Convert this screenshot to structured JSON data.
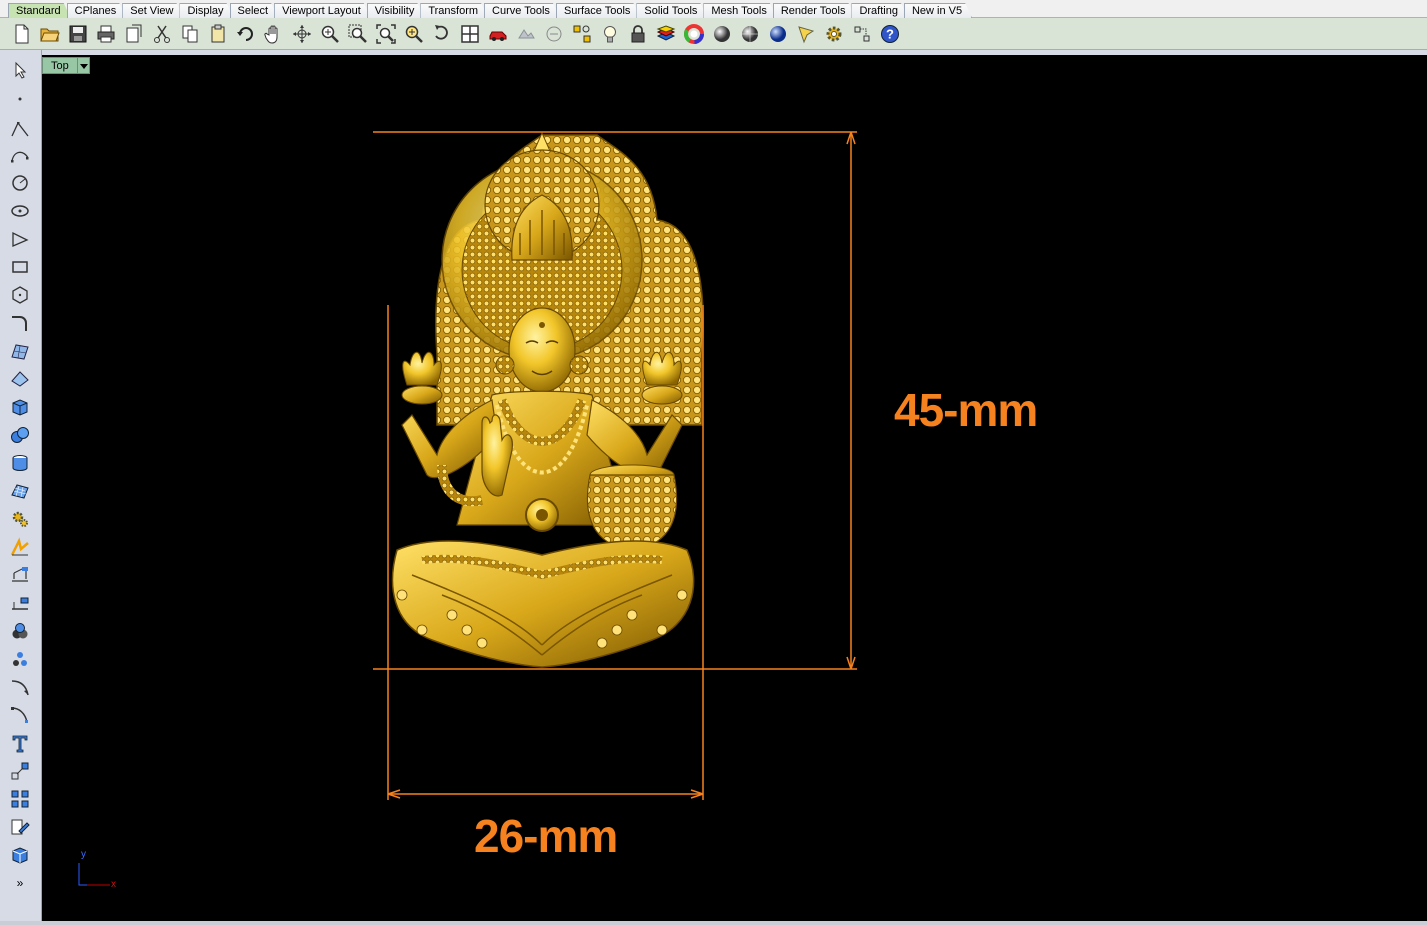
{
  "tabs": [
    "Standard",
    "CPlanes",
    "Set View",
    "Display",
    "Select",
    "Viewport Layout",
    "Visibility",
    "Transform",
    "Curve Tools",
    "Surface Tools",
    "Solid Tools",
    "Mesh Tools",
    "Render Tools",
    "Drafting",
    "New in V5"
  ],
  "active_tab": "Standard",
  "toolbar": {
    "icons": [
      "new-file-icon",
      "open-folder-icon",
      "save-icon",
      "print-icon",
      "import-icon",
      "cut-icon",
      "copy-icon",
      "paste-icon",
      "undo-icon",
      "pan-hand-icon",
      "rotate-view-icon",
      "zoom-in-icon",
      "zoom-window-icon",
      "zoom-extents-icon",
      "zoom-selected-icon",
      "rotate-arrow-icon",
      "four-viewports-icon",
      "car-icon",
      "disabled-icon",
      "circle-arrow-icon",
      "points-icon",
      "light-bulb-icon",
      "lock-icon",
      "layer-icon",
      "color-wheel-icon",
      "sphere-shade-icon",
      "sphere-render-icon",
      "sphere-blue-icon",
      "pen-tool-icon",
      "settings-gear-icon",
      "grid-snap-icon",
      "help-icon"
    ]
  },
  "left_toolbar": {
    "icons": [
      "select-arrow-icon",
      "point-icon",
      "polyline-icon",
      "curve-icon",
      "circle-icon",
      "ellipse-icon",
      "arc-icon",
      "rectangle-icon",
      "polygon-icon",
      "curve-from-object-icon",
      "surface-icon",
      "surface-edit-icon",
      "box-solid-icon",
      "boolean-icon",
      "cylinder-solid-icon",
      "mesh-icon",
      "gear-tool-icon",
      "render-analysis-icon",
      "dimension-icon",
      "dimension-line-icon",
      "boolean-union-icon",
      "points-cloud-icon",
      "fillet-icon",
      "curve-edit-icon",
      "text-icon",
      "transform-icon",
      "array-icon",
      "layout-icon",
      "box-3d-icon",
      "more-icon"
    ],
    "more_label": "»"
  },
  "viewport": {
    "name": "Top",
    "axis_y": "y",
    "axis_x": "x",
    "height_label": "45-mm",
    "width_label": "26-mm"
  },
  "colors": {
    "dimension": "#f5821f",
    "gold_light": "#ffe066",
    "gold": "#e8b820",
    "gold_dark": "#8a6400",
    "viewport_bg": "#000000",
    "tab_active": "#c7e3b2"
  }
}
